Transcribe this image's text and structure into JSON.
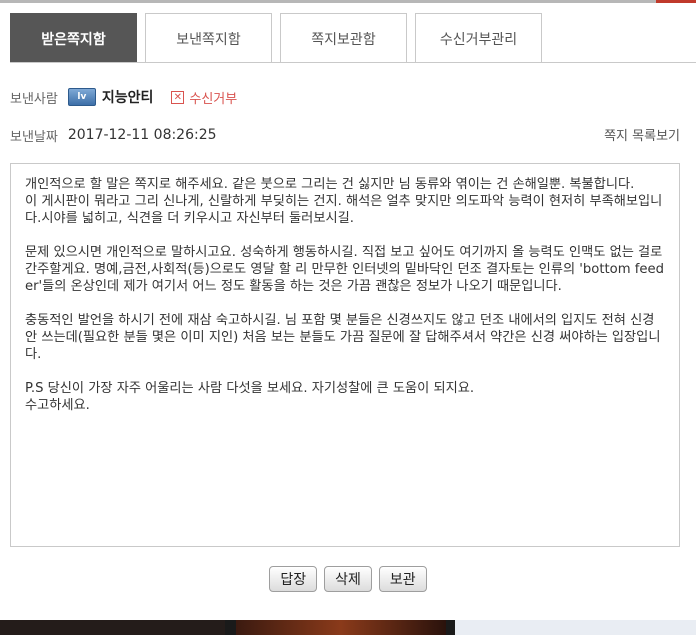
{
  "tabs": [
    {
      "label": "받은쪽지함",
      "active": true
    },
    {
      "label": "보낸쪽지함",
      "active": false
    },
    {
      "label": "쪽지보관함",
      "active": false
    },
    {
      "label": "수신거부관리",
      "active": false
    }
  ],
  "sender": {
    "label": "보낸사람",
    "level_icon_text": "lv",
    "name": "지능안티",
    "block_icon": "x-box-icon",
    "block_label": "수신거부"
  },
  "date": {
    "label": "보낸날짜",
    "value": "2017-12-11 08:26:25"
  },
  "list_link": "쪽지 목록보기",
  "message": "개인적으로 할 말은 쪽지로 해주세요. 같은 붓으로 그리는 건 싫지만 님 동류와 엮이는 건 손해일뿐. 복불합니다.\n이 게시판이 뭐라고 그리 신나게, 신랄하게 부딪히는 건지. 해석은 얼추 맞지만 의도파악 능력이 현저히 부족해보입니다.시야를 넓히고, 식견을 더 키우시고 자신부터 둘러보시길.\n\n문제 있으시면 개인적으로 말하시고요. 성숙하게 행동하시길. 직접 보고 싶어도 여기까지 올 능력도 인맥도 없는 걸로 간주할게요. 명예,금전,사회적(등)으로도 영달 할 리 만무한 인터넷의 밑바닥인 던조 결자토는 인류의 'bottom feeder'들의 온상인데 제가 여기서 어느 정도 활동을 하는 것은 가끔 괜찮은 정보가 나오기 때문입니다.\n\n충동적인 발언을 하시기 전에 재삼 숙고하시길. 님 포함 몇 분들은 신경쓰지도 않고 던조 내에서의 입지도 전혀 신경 안 쓰는데(필요한 분들 몇은 이미 지인) 처음 보는 분들도 가끔 질문에 잘 답해주셔서 약간은 신경 써야하는 입장입니다.\n\nP.S 당신이 가장 자주 어울리는 사람 다섯을 보세요. 자기성찰에 큰 도움이 되지요.\n수고하세요.",
  "buttons": {
    "reply": "답장",
    "delete": "삭제",
    "archive": "보관"
  }
}
